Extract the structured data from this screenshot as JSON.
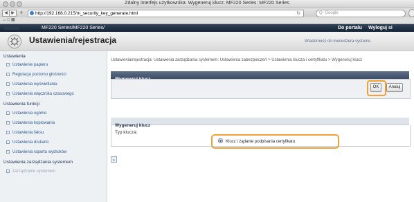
{
  "window": {
    "title": "Zdalny interfejs użytkownika: Wygeneruj klucz: MF220 Series: MF220 Series"
  },
  "browser": {
    "url": "http://192.168.0.215/m_security_key_generate.html",
    "search_placeholder": "Q- Google",
    "bookmarks": "↔ □ ▦"
  },
  "device_header": {
    "title": "MF220 Series/MF220 Series/",
    "portal_link": "Do portalu",
    "logout_link": "Wyloguj si"
  },
  "page": {
    "title": "Ustawienia/rejestracja",
    "message_link": "Wiadomość do menedżera systemu"
  },
  "sidebar": {
    "sections": [
      {
        "label": "Ustawienia",
        "items": [
          "Ustawienie papieru",
          "Regulacja poziomu głośności",
          "Ustawienia wyświetlania",
          "Ustawienia włącznika czasowego"
        ]
      },
      {
        "label": "Ustawienia funkcji",
        "items": [
          "Ustawienia ogólne",
          "Ustawienia kopiowania",
          "Ustawienia faksu",
          "Ustawienia drukarki",
          "Ustawienia raportu wydruków"
        ]
      },
      {
        "label": "Ustawienia zarządzania systemem",
        "items": [
          "Zarządzanie systemem"
        ]
      }
    ]
  },
  "content": {
    "breadcrumb": "Ustawienia/rejestracja: Ustawienia zarządzania systemem: Ustawienia zabezpieczeń > Ustawienia klucza i certyfikatu > Wygeneruj klucz",
    "panel_title": "Wygeneruj klucz",
    "ok_label": "OK",
    "cancel_label": "Anuluj",
    "section_title": "Wygeneruj klucz",
    "key_type_label": "Typ klucza:",
    "key_type_option": "Klucz i żądanie podpisania certyfikatu",
    "top_marker": "▲"
  },
  "colors": {
    "accent_ring": "#f0a035",
    "header_dark": "#1d2d40",
    "link": "#2e5b94"
  }
}
